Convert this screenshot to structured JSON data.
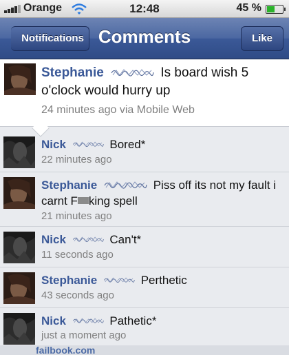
{
  "status_bar": {
    "carrier": "Orange",
    "time": "12:48",
    "battery": "45 %"
  },
  "nav": {
    "back_label": "Notifications",
    "title": "Comments",
    "like_label": "Like"
  },
  "post": {
    "author": "Stephanie",
    "text": "Is board wish 5 o'clock would hurry up",
    "meta": "24 minutes ago via Mobile Web"
  },
  "comments": [
    {
      "author": "Nick",
      "text": "Bored*",
      "time": "22 minutes ago"
    },
    {
      "author": "Stephanie",
      "text_before": "Piss off its not my fault i carnt F",
      "text_after": "king spell",
      "time": "21 minutes ago"
    },
    {
      "author": "Nick",
      "text": "Can't*",
      "time": "11 seconds ago"
    },
    {
      "author": "Stephanie",
      "text": "Perthetic",
      "time": "43 seconds ago"
    },
    {
      "author": "Nick",
      "text": "Pathetic*",
      "time": "just a moment ago"
    }
  ],
  "watermark": "failbook.com",
  "colors": {
    "nav": "#3b5998",
    "author": "#3b5998",
    "meta": "#7f7f7f"
  }
}
